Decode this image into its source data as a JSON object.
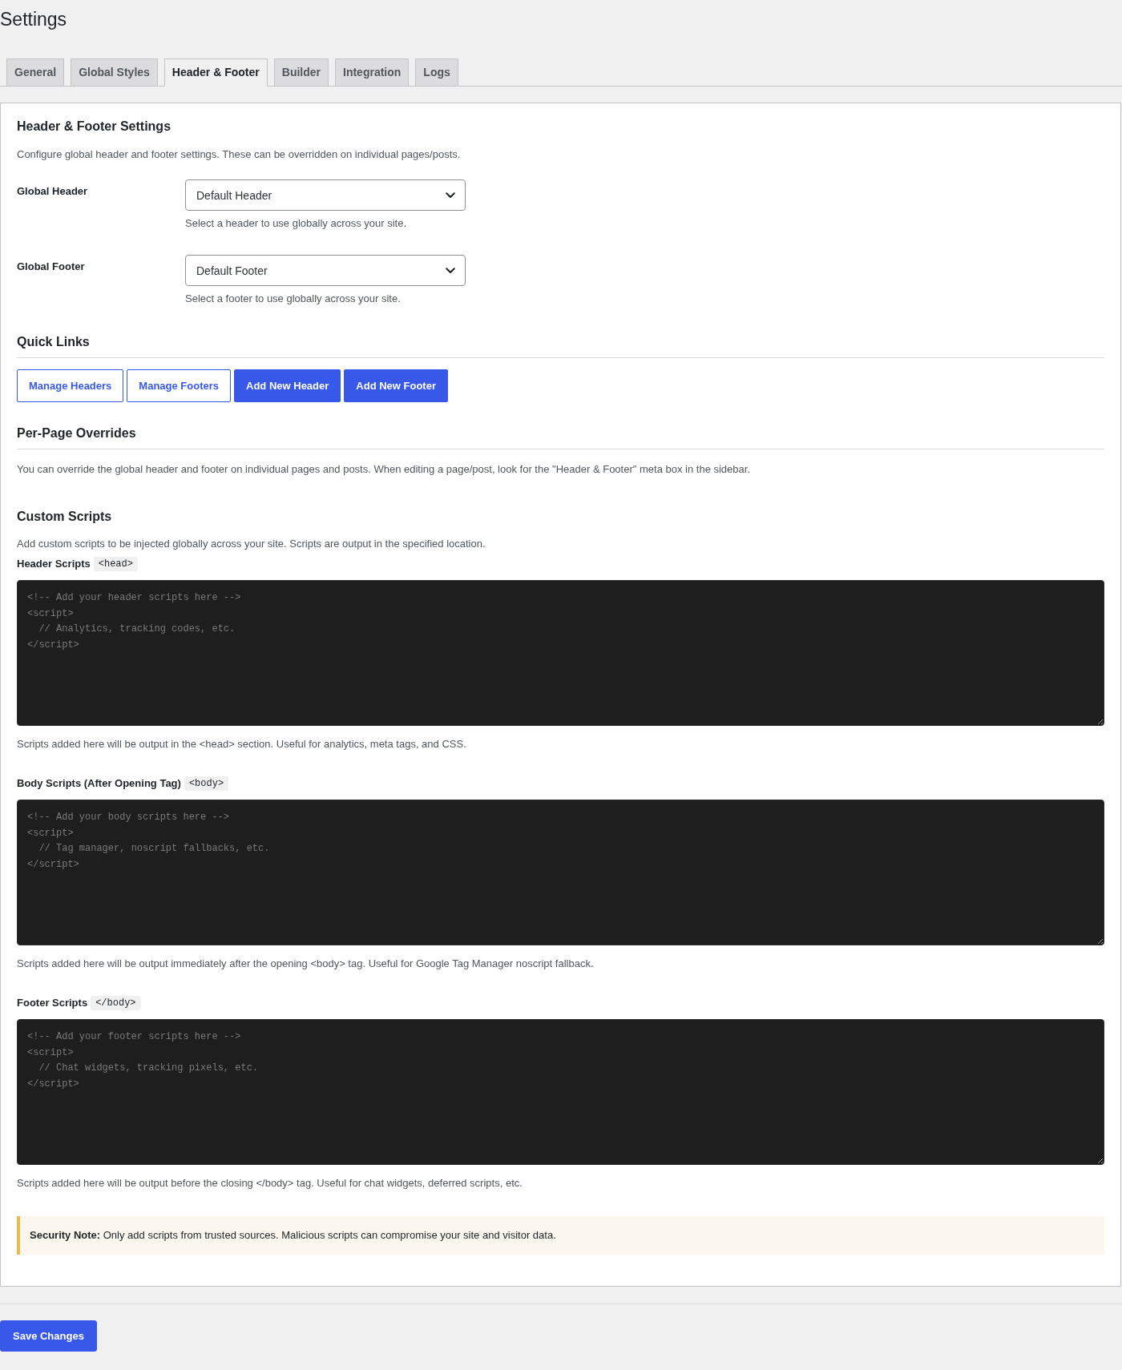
{
  "page_title": "Settings",
  "tabs": [
    {
      "label": "General",
      "selected": false
    },
    {
      "label": "Global Styles",
      "selected": false
    },
    {
      "label": "Header & Footer",
      "selected": true
    },
    {
      "label": "Builder",
      "selected": false
    },
    {
      "label": "Integration",
      "selected": false
    },
    {
      "label": "Logs",
      "selected": false
    }
  ],
  "section": {
    "title": "Header & Footer Settings",
    "description": "Configure global header and footer settings. These can be overridden on individual pages/posts."
  },
  "fields": [
    {
      "label": "Global Header",
      "value": "Default Header",
      "help": "Select a header to use globally across your site."
    },
    {
      "label": "Global Footer",
      "value": "Default Footer",
      "help": "Select a footer to use globally across your site."
    }
  ],
  "quick_links": {
    "title": "Quick Links",
    "buttons": [
      {
        "label": "Manage Headers",
        "kind": "outline"
      },
      {
        "label": "Manage Footers",
        "kind": "outline"
      },
      {
        "label": "Add New Header",
        "kind": "primary"
      },
      {
        "label": "Add New Footer",
        "kind": "primary"
      }
    ]
  },
  "per_page_overrides": {
    "title": "Per-Page Overrides",
    "text": "You can override the global header and footer on individual pages and posts. When editing a page/post, look for the \"Header & Footer\" meta box in the sidebar."
  },
  "custom_scripts": {
    "title": "Custom Scripts",
    "description": "Add custom scripts to be injected globally across your site. Scripts are output in the specified location.",
    "scripts": [
      {
        "label": "Header Scripts",
        "tag": "<head>",
        "placeholder": "<!-- Add your header scripts here -->\n<script>\n  // Analytics, tracking codes, etc.\n</script>",
        "help": "Scripts added here will be output in the <head> section. Useful for analytics, meta tags, and CSS."
      },
      {
        "label": "Body Scripts (After Opening Tag)",
        "tag": "<body>",
        "placeholder": "<!-- Add your body scripts here -->\n<script>\n  // Tag manager, noscript fallbacks, etc.\n</script>",
        "help": "Scripts added here will be output immediately after the opening <body> tag. Useful for Google Tag Manager noscript fallback."
      },
      {
        "label": "Footer Scripts",
        "tag": "</body>",
        "placeholder": "<!-- Add your footer scripts here -->\n<script>\n  // Chat widgets, tracking pixels, etc.\n</script>",
        "help": "Scripts added here will be output before the closing </body> tag. Useful for chat widgets, deferred scripts, etc."
      }
    ]
  },
  "security_note": "**Security Note:** Only add scripts from trusted sources. Malicious scripts can compromise your site and visitor data.",
  "save_button": "Save Changes"
}
